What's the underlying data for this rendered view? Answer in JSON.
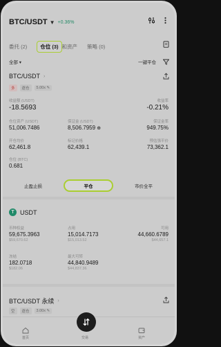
{
  "header": {
    "pair": "BTC/USDT",
    "change": "+0.36%"
  },
  "tabs": [
    {
      "label": "委托 (2)"
    },
    {
      "label": "仓位 (3)"
    },
    {
      "label": "和资产"
    },
    {
      "label": "策略 (0)"
    }
  ],
  "filters": {
    "left": "全部",
    "right": "一键平仓"
  },
  "position": {
    "title": "BTC/USDT",
    "tags": [
      "多",
      "逐仓",
      "5.00x"
    ],
    "pnl_label": "收益额 (USDT)",
    "pnl_value": "-18.5693",
    "roi_label": "收益率",
    "roi_value": "-0.21%",
    "size_label": "仓位资产 (USDT)",
    "size_value": "51,006.7486",
    "margin_label": "保证金 (USDT)",
    "margin_value": "8,506.7959",
    "ratio_label": "保证金率",
    "ratio_value": "949.75%",
    "entry_label": "开仓均价",
    "entry_value": "62,461.8",
    "mark_label": "标记价格",
    "mark_value": "62,439.1",
    "liq_label": "预估强平价",
    "liq_value": "73,362.1",
    "qty_label": "仓位 (BTC)",
    "qty_value": "0.681",
    "buttons": [
      "止盈止损",
      "平仓",
      "市价全平"
    ]
  },
  "asset": {
    "coin": "USDT",
    "equity_label": "币种权益",
    "equity_value": "59,675.3963",
    "equity_sub": "$59,670.62",
    "used_label": "占用",
    "used_value": "15,014.7173",
    "used_sub": "$15,013.52",
    "avail_label": "可用",
    "avail_value": "44,660.6789",
    "avail_sub": "$44,657.1",
    "open_label": "冻结",
    "open_value": "182.0718",
    "open_sub": "$182.06",
    "max_label": "最大可转",
    "max_value": "44,840.9489",
    "max_sub": "$44,837.36"
  },
  "position2": {
    "title": "BTC/USDT 永续",
    "tags": [
      "空",
      "逐仓",
      "3.00x"
    ]
  },
  "nav": {
    "left": "首页",
    "center": "交易",
    "right": "资产"
  }
}
